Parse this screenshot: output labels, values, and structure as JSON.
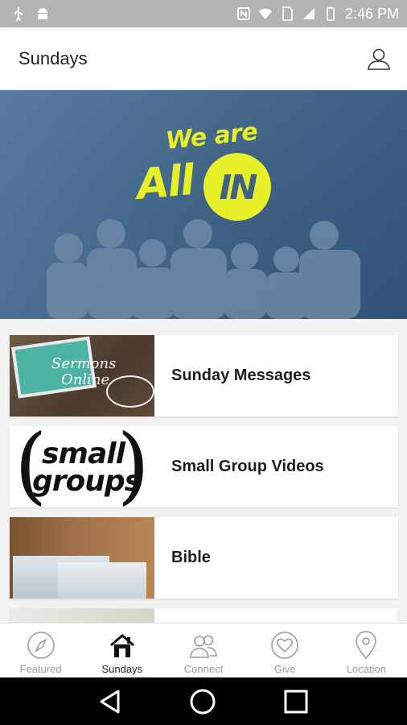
{
  "status_bar": {
    "time": "2:46 PM",
    "left_icons": [
      "usb-icon",
      "android-debug-icon"
    ],
    "right_icons": [
      "nfc-icon",
      "wifi-icon",
      "sim-icon",
      "signal-icon",
      "battery-icon"
    ]
  },
  "app_bar": {
    "title": "Sundays",
    "profile_icon": "person-icon"
  },
  "hero": {
    "tagline_top": "We are",
    "tagline_main": "All",
    "tagline_circle": "IN"
  },
  "items": [
    {
      "label": "Sunday Messages",
      "thumb_text_1": "Sermons",
      "thumb_text_2": "Online"
    },
    {
      "label": "Small Group Videos",
      "thumb_text_1": "small",
      "thumb_text_2": "groups"
    },
    {
      "label": "Bible"
    }
  ],
  "bottom_nav": [
    {
      "label": "Featured",
      "icon": "compass-icon",
      "active": false
    },
    {
      "label": "Sundays",
      "icon": "house-icon",
      "active": true
    },
    {
      "label": "Connect",
      "icon": "people-icon",
      "active": false
    },
    {
      "label": "Give",
      "icon": "heart-icon",
      "active": false
    },
    {
      "label": "Location",
      "icon": "map-pin-icon",
      "active": false
    }
  ],
  "colors": {
    "accent_yellow": "#e6ef27",
    "hero_blue": "#3f6283",
    "status_bar": "#b3b3b3"
  }
}
